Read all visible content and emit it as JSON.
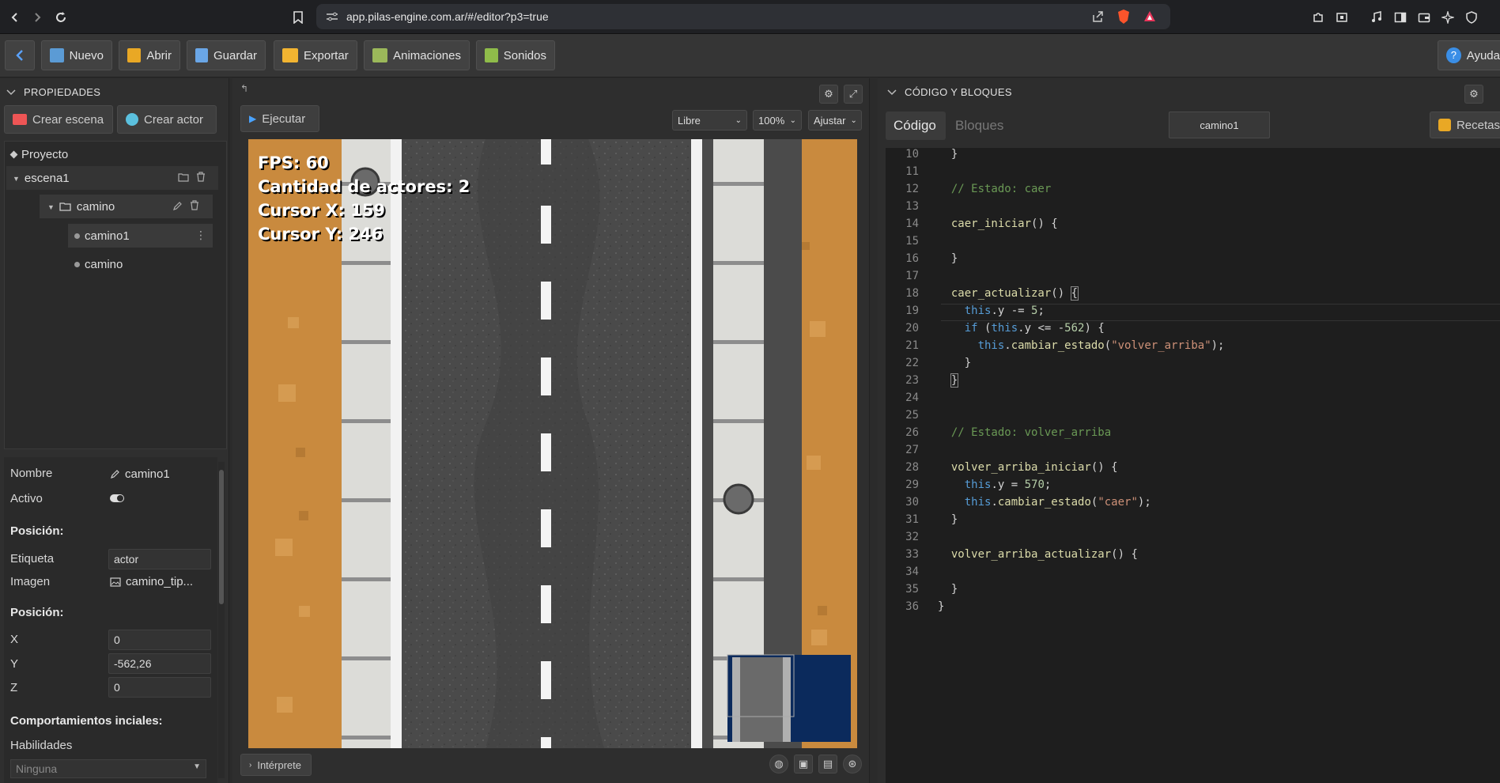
{
  "browser": {
    "url": "app.pilas-engine.com.ar/#/editor?p3=true"
  },
  "toolbar": {
    "buttons": [
      "Nuevo",
      "Abrir",
      "Guardar",
      "Exportar",
      "Animaciones",
      "Sonidos"
    ],
    "help": "Ayuda"
  },
  "left": {
    "header": "PROPIEDADES",
    "create_scene": "Crear escena",
    "create_actor": "Crear actor",
    "tree": {
      "project": "Proyecto",
      "scene": "escena1",
      "folder": "camino",
      "actor_selected": "camino1",
      "actor_other": "camino"
    },
    "props": {
      "name_label": "Nombre",
      "name_value": "camino1",
      "active_label": "Activo",
      "position_title": "Posición:",
      "tag_label": "Etiqueta",
      "tag_value": "actor",
      "image_label": "Imagen",
      "image_value": "camino_tip...",
      "position_title2": "Posición:",
      "x_label": "X",
      "x_value": "0",
      "y_label": "Y",
      "y_value": "-562,26",
      "z_label": "Z",
      "z_value": "0",
      "behaviours_title": "Comportamientos inciales:",
      "skills_label": "Habilidades",
      "skills_value": "Ninguna"
    }
  },
  "center": {
    "run": "Ejecutar",
    "mode": "Libre",
    "zoom": "100%",
    "fit": "Ajustar",
    "hud": {
      "fps": "FPS: 60",
      "actors": "Cantidad de actores: 2",
      "cursor_x": "Cursor X: 159",
      "cursor_y": "Cursor Y: 246"
    },
    "interpreter": "Intérprete"
  },
  "right": {
    "header": "CÓDIGO Y BLOQUES",
    "tab_code": "Código",
    "tab_blocks": "Bloques",
    "file_tab": "camino1",
    "recipes": "Recetas",
    "line_numbers": [
      "10",
      "11",
      "12",
      "13",
      "14",
      "15",
      "16",
      "17",
      "18",
      "19",
      "20",
      "21",
      "22",
      "23",
      "24",
      "25",
      "26",
      "27",
      "28",
      "29",
      "30",
      "31",
      "32",
      "33",
      "34",
      "35",
      "36"
    ]
  },
  "colors": {
    "sand": "#c98a3e",
    "asphalt": "#4b4b4b",
    "sidewalk": "#d9d9d6",
    "minimap": "#0b2a5c"
  }
}
